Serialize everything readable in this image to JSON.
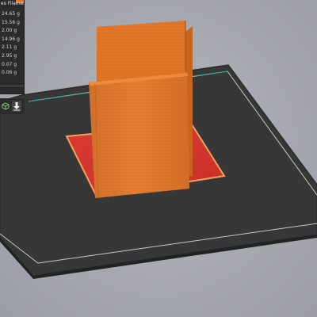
{
  "legend": {
    "header": "es Filament",
    "rows": [
      "24.65 g",
      "15.56 g",
      "2.00 g",
      "14.96 g",
      "2.11 g",
      "2.95 g",
      "0.07 g",
      "0.06 g"
    ]
  },
  "toolbar": {
    "buttons": [
      {
        "icon": "cube-icon"
      },
      {
        "icon": "export-arrow-icon"
      }
    ]
  },
  "colors": {
    "bed": "#373737",
    "bed_border": "#c8c8c8",
    "model": "#e07a2e",
    "model_dark": "#c9691f",
    "brim": "#d93a34",
    "accent": "#e2741f",
    "panel": "#2b2b2b"
  }
}
